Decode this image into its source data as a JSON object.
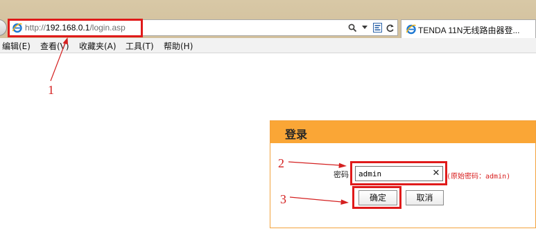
{
  "browser": {
    "address": {
      "prefix": "http://",
      "host": "192.168.0.1",
      "path": "/login.asp"
    },
    "tab_title": "TENDA 11N无线路由器登..."
  },
  "menu": {
    "items": [
      {
        "label": "编辑(E)"
      },
      {
        "label": "查看(V)"
      },
      {
        "label": "收藏夹(A)"
      },
      {
        "label": "工具(T)"
      },
      {
        "label": "帮助(H)"
      }
    ]
  },
  "login": {
    "title": "登录",
    "password_label": "密码",
    "password_value": "admin",
    "clear_glyph": "✕",
    "hint": "(原始密码：admin)",
    "ok_label": "确定",
    "cancel_label": "取消"
  },
  "annotations": [
    {
      "number": "1"
    },
    {
      "number": "2"
    },
    {
      "number": "3"
    }
  ],
  "colors": {
    "panel_header": "#faa636",
    "annotation_red": "#e01a1a",
    "hint_red": "#d81e1e",
    "chrome": "#d8c8a6"
  },
  "icons": {
    "browser": "ie-icon",
    "search": "search-icon",
    "dropdown": "chevron-down-icon",
    "compat": "compatibility-view-icon",
    "refresh": "refresh-icon",
    "clear": "clear-x-icon"
  }
}
